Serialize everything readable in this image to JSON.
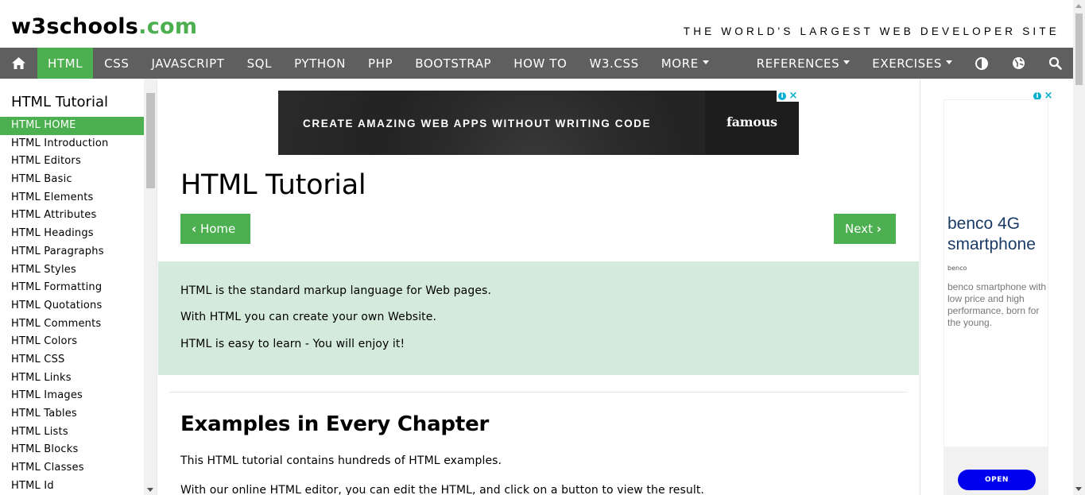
{
  "header": {
    "logo_main": "w3schools",
    "logo_suffix": ".com",
    "tagline": "THE WORLD'S LARGEST WEB DEVELOPER SITE",
    "brand_color": "#4CAF50"
  },
  "nav": {
    "home_icon": "home-icon",
    "items": [
      {
        "label": "HTML",
        "active": true
      },
      {
        "label": "CSS"
      },
      {
        "label": "JAVASCRIPT"
      },
      {
        "label": "SQL"
      },
      {
        "label": "PYTHON"
      },
      {
        "label": "PHP"
      },
      {
        "label": "BOOTSTRAP"
      },
      {
        "label": "HOW TO"
      },
      {
        "label": "W3.CSS"
      },
      {
        "label": "MORE"
      }
    ],
    "right": {
      "references": "REFERENCES",
      "exercises": "EXERCISES",
      "icons": [
        "contrast-icon",
        "globe-icon",
        "search-icon"
      ]
    },
    "bar_color": "#5f5f5f"
  },
  "sidebar": {
    "title": "HTML Tutorial",
    "items": [
      "HTML HOME",
      "HTML Introduction",
      "HTML Editors",
      "HTML Basic",
      "HTML Elements",
      "HTML Attributes",
      "HTML Headings",
      "HTML Paragraphs",
      "HTML Styles",
      "HTML Formatting",
      "HTML Quotations",
      "HTML Comments",
      "HTML Colors",
      "HTML CSS",
      "HTML Links",
      "HTML Images",
      "HTML Tables",
      "HTML Lists",
      "HTML Blocks",
      "HTML Classes",
      "HTML Id"
    ],
    "active_index": 0
  },
  "ad_banner": {
    "text": "CREATE AMAZING WEB APPS WITHOUT WRITING CODE",
    "brand": "famous"
  },
  "main": {
    "title": "HTML Tutorial",
    "prev_label": "Home",
    "next_label": "Next",
    "intro": [
      "HTML is the standard markup language for Web pages.",
      "With HTML you can create your own Website.",
      "HTML is easy to learn - You will enjoy it!"
    ],
    "intro_bg": "#d4eadb",
    "section_title": "Examples in Every Chapter",
    "paragraphs": [
      "This HTML tutorial contains hundreds of HTML examples.",
      "With our online HTML editor, you can edit the HTML, and click on a button to view the result."
    ]
  },
  "side_ad": {
    "headline": "benco 4G smartphone",
    "brand": "benco",
    "description": "benco smartphone with low price and high performance, born for the young.",
    "cta": "OPEN"
  }
}
